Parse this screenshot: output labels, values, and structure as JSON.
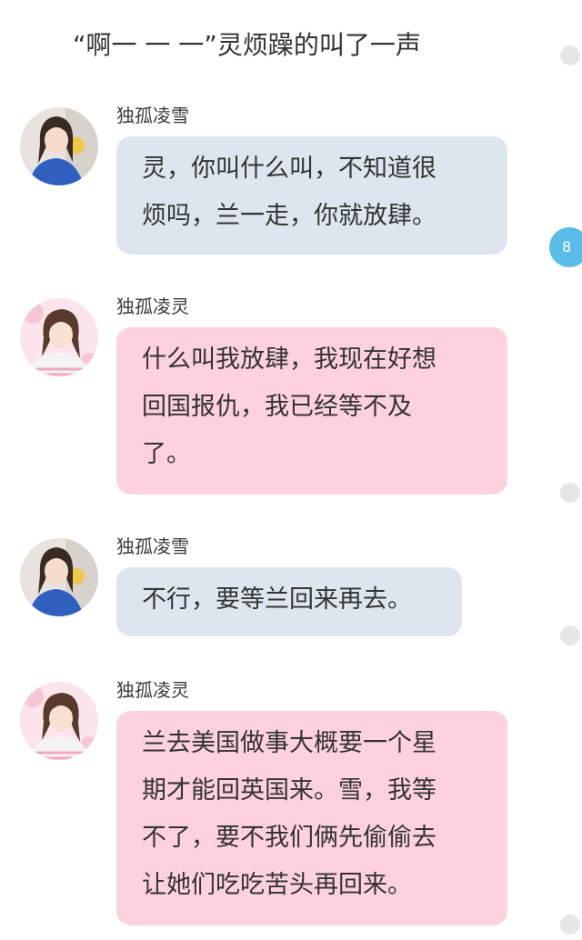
{
  "narration": "“啊一 一 一”灵烦躁的叫了一声",
  "badge_count": "8",
  "messages": [
    {
      "sender": "独孤凌雪",
      "avatar": "avatar-snow",
      "bubble_color": "#dde6ee",
      "lines": [
        "灵，你叫什么叫，不知道很",
        "烦吗，兰一走，你就放肆。"
      ]
    },
    {
      "sender": "独孤凌灵",
      "avatar": "avatar-ling",
      "bubble_color": "#fdd2dc",
      "lines": [
        "什么叫我放肆，我现在好想",
        "回国报仇，我已经等不及",
        "了。"
      ]
    },
    {
      "sender": "独孤凌雪",
      "avatar": "avatar-snow",
      "bubble_color": "#dde6ee",
      "lines": [
        "不行，要等兰回来再去。"
      ]
    },
    {
      "sender": "独孤凌灵",
      "avatar": "avatar-ling",
      "bubble_color": "#fdd2dc",
      "lines": [
        "兰去美国做事大概要一个星",
        "期才能回英国来。雪，我等",
        "不了，要不我们俩先偷偷去",
        "让她们吃吃苦头再回来。"
      ]
    }
  ]
}
